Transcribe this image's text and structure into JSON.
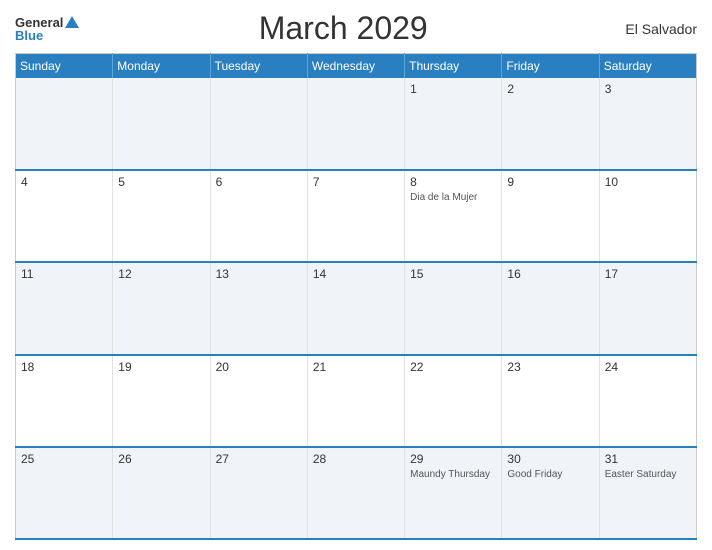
{
  "header": {
    "logo_general": "General",
    "logo_blue": "Blue",
    "title": "March 2029",
    "country": "El Salvador"
  },
  "weekdays": [
    "Sunday",
    "Monday",
    "Tuesday",
    "Wednesday",
    "Thursday",
    "Friday",
    "Saturday"
  ],
  "weeks": [
    [
      {
        "day": "",
        "holiday": ""
      },
      {
        "day": "",
        "holiday": ""
      },
      {
        "day": "",
        "holiday": ""
      },
      {
        "day": "",
        "holiday": ""
      },
      {
        "day": "1",
        "holiday": ""
      },
      {
        "day": "2",
        "holiday": ""
      },
      {
        "day": "3",
        "holiday": ""
      }
    ],
    [
      {
        "day": "4",
        "holiday": ""
      },
      {
        "day": "5",
        "holiday": ""
      },
      {
        "day": "6",
        "holiday": ""
      },
      {
        "day": "7",
        "holiday": ""
      },
      {
        "day": "8",
        "holiday": "Dia de la Mujer"
      },
      {
        "day": "9",
        "holiday": ""
      },
      {
        "day": "10",
        "holiday": ""
      }
    ],
    [
      {
        "day": "11",
        "holiday": ""
      },
      {
        "day": "12",
        "holiday": ""
      },
      {
        "day": "13",
        "holiday": ""
      },
      {
        "day": "14",
        "holiday": ""
      },
      {
        "day": "15",
        "holiday": ""
      },
      {
        "day": "16",
        "holiday": ""
      },
      {
        "day": "17",
        "holiday": ""
      }
    ],
    [
      {
        "day": "18",
        "holiday": ""
      },
      {
        "day": "19",
        "holiday": ""
      },
      {
        "day": "20",
        "holiday": ""
      },
      {
        "day": "21",
        "holiday": ""
      },
      {
        "day": "22",
        "holiday": ""
      },
      {
        "day": "23",
        "holiday": ""
      },
      {
        "day": "24",
        "holiday": ""
      }
    ],
    [
      {
        "day": "25",
        "holiday": ""
      },
      {
        "day": "26",
        "holiday": ""
      },
      {
        "day": "27",
        "holiday": ""
      },
      {
        "day": "28",
        "holiday": ""
      },
      {
        "day": "29",
        "holiday": "Maundy Thursday"
      },
      {
        "day": "30",
        "holiday": "Good Friday"
      },
      {
        "day": "31",
        "holiday": "Easter Saturday"
      }
    ]
  ]
}
